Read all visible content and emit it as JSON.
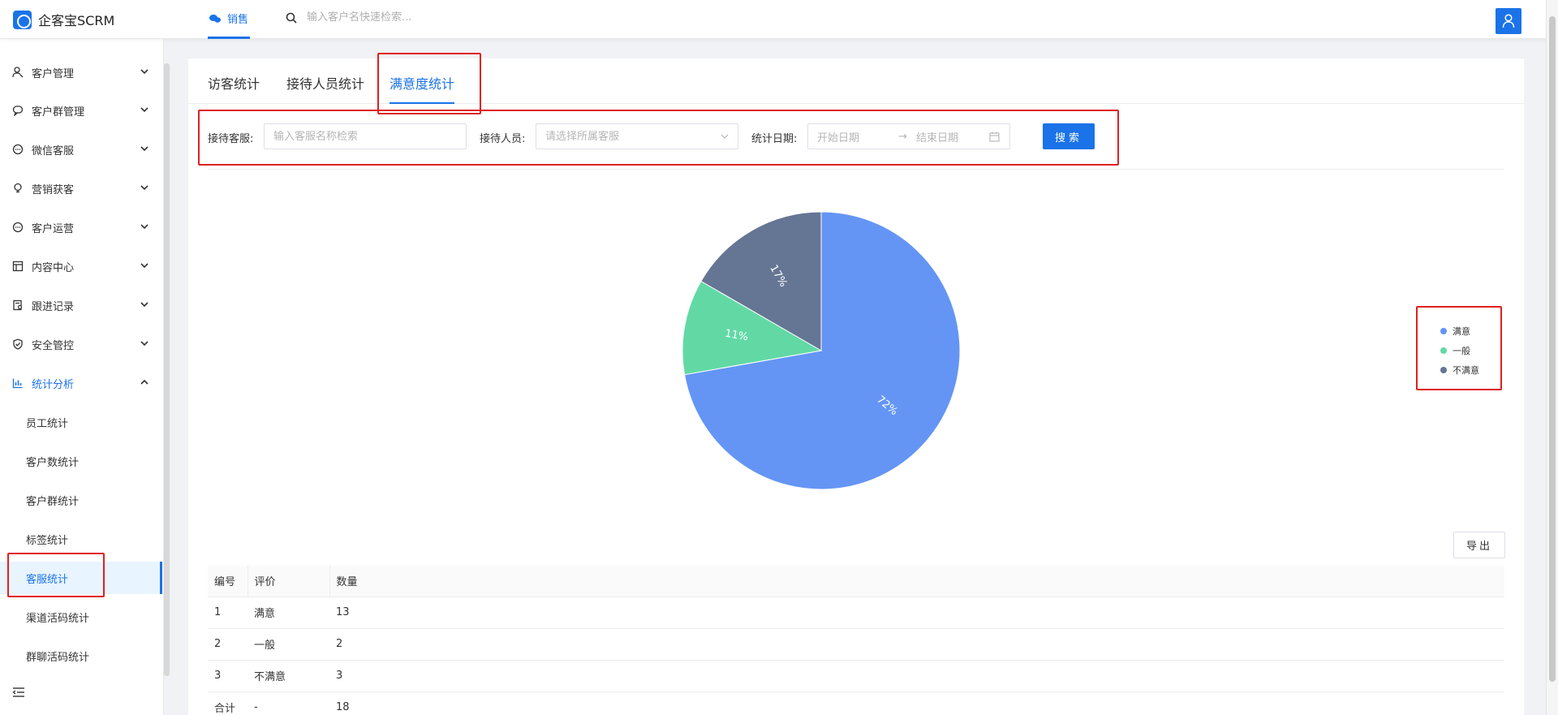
{
  "app": {
    "title": "企客宝SCRM"
  },
  "header": {
    "active_tab": "销售",
    "search_placeholder": "输入客户名快速检索..."
  },
  "sidebar": {
    "items": [
      {
        "label": "客户管理",
        "icon": "user-icon"
      },
      {
        "label": "客户群管理",
        "icon": "chat-icon"
      },
      {
        "label": "微信客服",
        "icon": "message-icon"
      },
      {
        "label": "营销获客",
        "icon": "bulb-icon"
      },
      {
        "label": "客户运营",
        "icon": "message-icon"
      },
      {
        "label": "内容中心",
        "icon": "building-icon"
      },
      {
        "label": "跟进记录",
        "icon": "document-icon"
      },
      {
        "label": "安全管控",
        "icon": "shield-icon"
      },
      {
        "label": "统计分析",
        "icon": "bar-chart-icon"
      }
    ],
    "sub_items": [
      "员工统计",
      "客户数统计",
      "客户群统计",
      "标签统计",
      "客服统计",
      "渠道活码统计",
      "群聊活码统计"
    ]
  },
  "tabs": [
    "访客统计",
    "接待人员统计",
    "满意度统计"
  ],
  "filters": {
    "service_label": "接待客服:",
    "service_placeholder": "输入客服名称检索",
    "staff_label": "接待人员:",
    "staff_placeholder": "请选择所属客服",
    "date_label": "统计日期:",
    "start_placeholder": "开始日期",
    "end_placeholder": "结束日期",
    "search_button": "搜索"
  },
  "chart_data": {
    "type": "pie",
    "slices": [
      {
        "name": "满意",
        "value": 13,
        "label": "72%",
        "color": "#6495f5"
      },
      {
        "name": "一般",
        "value": 2,
        "label": "11%",
        "color": "#62d9a5"
      },
      {
        "name": "不满意",
        "value": 3,
        "label": "17%",
        "color": "#657594"
      }
    ]
  },
  "export_button": "导出",
  "table": {
    "headers": [
      "编号",
      "评价",
      "数量"
    ],
    "rows": [
      [
        "1",
        "满意",
        "13"
      ],
      [
        "2",
        "一般",
        "2"
      ],
      [
        "3",
        "不满意",
        "3"
      ],
      [
        "合计",
        "-",
        "18"
      ]
    ]
  }
}
